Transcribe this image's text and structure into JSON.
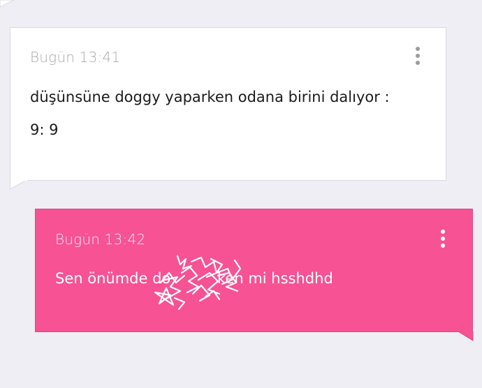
{
  "colors": {
    "background": "#eeeef4",
    "incoming_bubble": "#ffffff",
    "outgoing_bubble": "#f65294",
    "timestamp_incoming": "#a9a9ad",
    "text_incoming": "#1b1b1b",
    "text_outgoing": "#ffffff"
  },
  "messages": [
    {
      "direction": "incoming",
      "timestamp": "Bugün 13:41",
      "lines": [
        "düşünsüne doggy yaparken odana birini dalıyor :",
        "9: 9"
      ],
      "menu_icon": "more-vertical-icon"
    },
    {
      "direction": "outgoing",
      "timestamp": "Bugün 13:42",
      "lines": [
        "Sen önümde do          ken mi hsshdhd"
      ],
      "menu_icon": "more-vertical-icon",
      "redaction_icon": "scribble-redaction-icon"
    }
  ]
}
